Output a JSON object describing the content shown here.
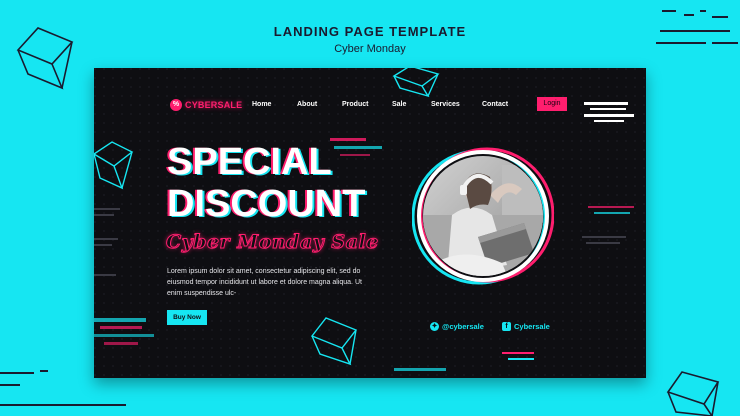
{
  "outer": {
    "title": "LANDING PAGE TEMPLATE",
    "subtitle": "Cyber Monday"
  },
  "brand": {
    "name": "CYBERSALE",
    "mark": "%"
  },
  "nav": {
    "items": [
      {
        "label": "Home"
      },
      {
        "label": "About"
      },
      {
        "label": "Product"
      },
      {
        "label": "Sale"
      },
      {
        "label": "Services"
      },
      {
        "label": "Contact"
      }
    ],
    "login_label": "Login"
  },
  "hero": {
    "headline_line1": "SPECIAL",
    "headline_line2": "DISCOUNT",
    "script_title": "Cyber Monday Sale",
    "paragraph": "Lorem ipsum dolor sit amet, consectetur adipiscing elit, sed do eiusmod tempor incididunt ut labore et dolore magna aliqua. Ut enim suspendisse ulc-",
    "cta_label": "Buy Now"
  },
  "social": {
    "twitter": "@cybersale",
    "facebook": "Cybersale"
  },
  "colors": {
    "accent_pink": "#ff1e6e",
    "accent_cyan": "#16e6f2",
    "card_bg": "#0e0e12"
  },
  "icons": {
    "twitter": "twitter-icon",
    "facebook": "facebook-icon"
  }
}
